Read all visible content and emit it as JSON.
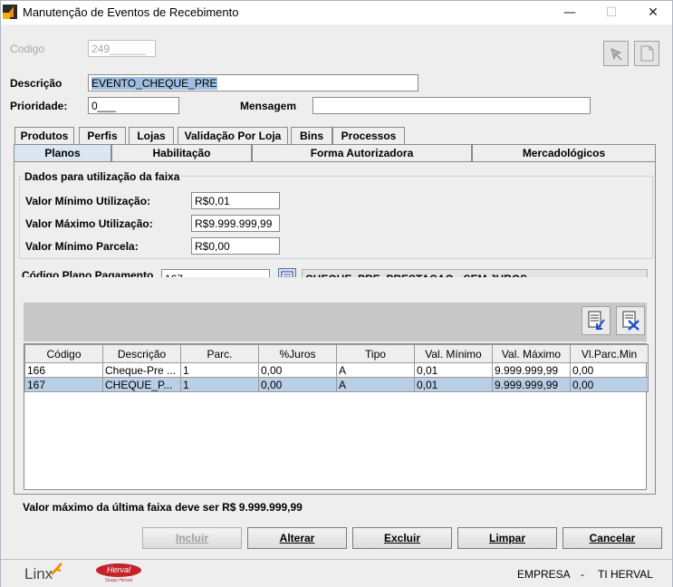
{
  "window": {
    "title": "Manutenção de Eventos de Recebimento",
    "minimize": "—",
    "maximize": "☐",
    "close": "✕"
  },
  "form": {
    "codigo_label": "Codigo",
    "codigo_value": "249______",
    "descricao_label": "Descrição",
    "descricao_value": "EVENTO_CHEQUE_PRE",
    "prioridade_label": "Prioridade:",
    "prioridade_value": "0___",
    "mensagem_label": "Mensagem",
    "mensagem_value": ""
  },
  "tabs_row1": [
    "Produtos",
    "Perfis",
    "Lojas",
    "Validação Por Loja",
    "Bins",
    "Processos"
  ],
  "tabs_row2": [
    "Planos",
    "Habilitação",
    "Forma Autorizadora",
    "Mercadológicos"
  ],
  "faixa": {
    "title": "Dados para utilização da faixa",
    "min_label": "Valor Mínimo Utilização:",
    "min_value": "R$0,01",
    "max_label": "Valor Máximo Utilização:",
    "max_value": "R$9.999.999,99",
    "parcela_label": "Valor Mínimo Parcela:",
    "parcela_value": "R$0,00"
  },
  "plano": {
    "label": "Código Plano Pagamento",
    "code": "167",
    "desc": "CHEQUE_PRE_PRESTACAO - SEM JUROS"
  },
  "table": {
    "columns": [
      "Código",
      "Descrição",
      "Parc.",
      "%Juros",
      "Tipo",
      "Val. Mínimo",
      "Val. Máximo",
      "Vl.Parc.Min"
    ],
    "rows": [
      [
        "166",
        "Cheque-Pre ...",
        "1",
        "0,00",
        "A",
        "0,01",
        "9.999.999,99",
        "0,00"
      ],
      [
        "167",
        "CHEQUE_P...",
        "1",
        "0,00",
        "A",
        "0,01",
        "9.999.999,99",
        "0,00"
      ]
    ],
    "selected_row": 1
  },
  "note": "Valor máximo da última faixa deve ser R$ 9.999.999,99",
  "buttons": {
    "incluir": "Incluir",
    "alterar": "Alterar",
    "excluir": "Excluir",
    "limpar": "Limpar",
    "cancelar": "Cancelar"
  },
  "status": {
    "brand": "Linx",
    "logo": "Herval",
    "logo_sub": "Grupo Herval",
    "empresa": "EMPRESA",
    "sep": "-",
    "empresa_value": "TI HERVAL"
  },
  "colors": {
    "selected_row": "#b8cfe5",
    "active_tab": "#dbe6f2",
    "brand_orange": "#f08a00",
    "herval_red": "#c4232b"
  }
}
